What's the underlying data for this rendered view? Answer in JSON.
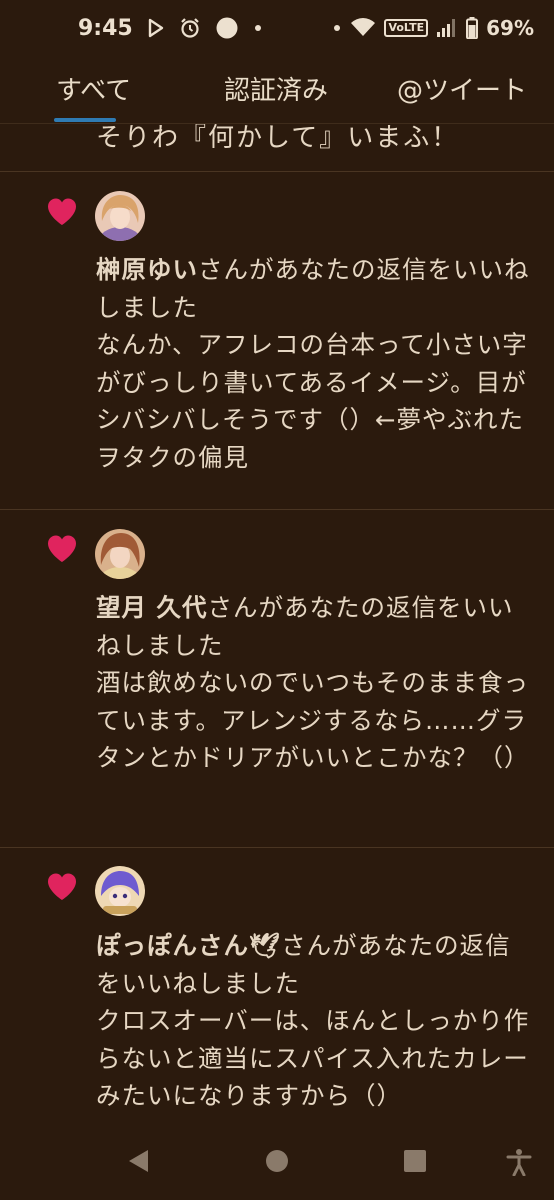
{
  "status_bar": {
    "time": "9:45",
    "volte": "VoLTE",
    "battery": "69%"
  },
  "tabs": [
    {
      "label": "すべて",
      "active": true
    },
    {
      "label": "認証済み",
      "active": false
    },
    {
      "label": "@ツイート",
      "active": false
    }
  ],
  "partial_item": {
    "text": "そりわ『何かして』いまふ！"
  },
  "notifications": [
    {
      "actor": "榊原ゆい",
      "action": "さんがあなたの返信をいいねしました",
      "body": "なんか、アフレコの台本って小さい字がびっしり書いてあるイメージ。目がシバシバしそうです（）←夢やぶれたヲタクの偏見"
    },
    {
      "actor": "望月 久代",
      "action": "さんがあなたの返信をいいねしました",
      "body": "酒は飲めないのでいつもそのまま食っています。アレンジするなら……グラタンとかドリアがいいとこかな？（）"
    },
    {
      "actor": "ぽっぽんさん🕊",
      "action": "さんがあなたの返信をいいねしました",
      "body": "クロスオーバーは、ほんとしっかり作らないと適当にスパイス入れたカレーみたいになりますから（）"
    }
  ],
  "colors": {
    "background": "#2b1a0d",
    "text": "#e6d7c3",
    "heart": "#e0245e",
    "tab_indicator": "#2f7bb3"
  }
}
